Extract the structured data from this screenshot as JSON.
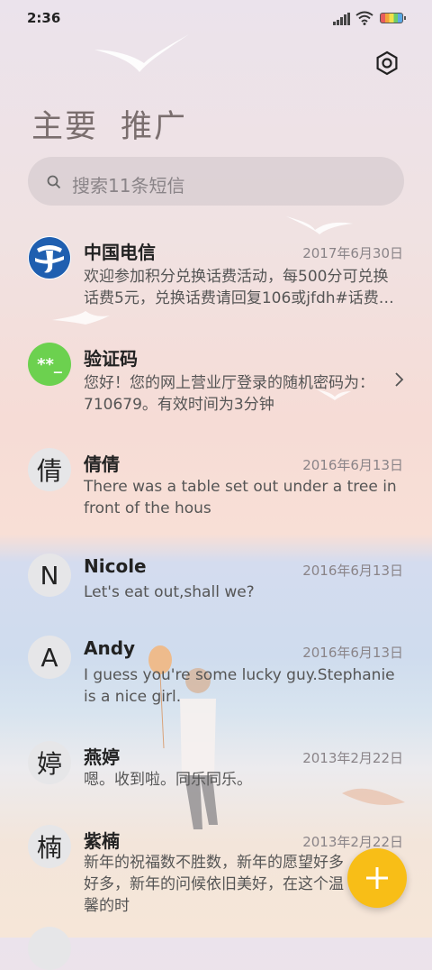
{
  "status_bar": {
    "time": "2:36"
  },
  "tabs": [
    "主要",
    "推广"
  ],
  "search": {
    "placeholder": "搜索11条短信"
  },
  "messages": [
    {
      "name": "中国电信",
      "date": "2017年6月30日",
      "text": "欢迎参加积分兑换话费活动，每500分可兑换话费5元，兑换话费请回复106或jfdh#话费…",
      "avatar": ""
    },
    {
      "name": "验证码",
      "date": "",
      "text": "您好！您的网上营业厅登录的随机密码为：710679。有效时间为3分钟",
      "avatar": "**_"
    },
    {
      "name": "倩倩",
      "date": "2016年6月13日",
      "text": "There was a table set out under a tree in front of the hous",
      "avatar": "倩"
    },
    {
      "name": "Nicole",
      "date": "2016年6月13日",
      "text": "Let's eat out,shall we?",
      "avatar": "N"
    },
    {
      "name": "Andy",
      "date": "2016年6月13日",
      "text": "I guess you're some lucky guy.Stephanie is a nice girl.",
      "avatar": "A"
    },
    {
      "name": "燕婷",
      "date": "2013年2月22日",
      "text": "嗯。收到啦。同乐同乐。",
      "avatar": "婷"
    },
    {
      "name": "紫楠",
      "date": "2013年2月22日",
      "text": "新年的祝福数不胜数，新年的愿望好多好多，新年的问候依旧美好，在这个温馨的时",
      "avatar": "楠"
    }
  ],
  "colors": {
    "fab": "#f8be17",
    "verify_avatar": "#6cd14f",
    "telecom_blue": "#1f5fb0"
  }
}
